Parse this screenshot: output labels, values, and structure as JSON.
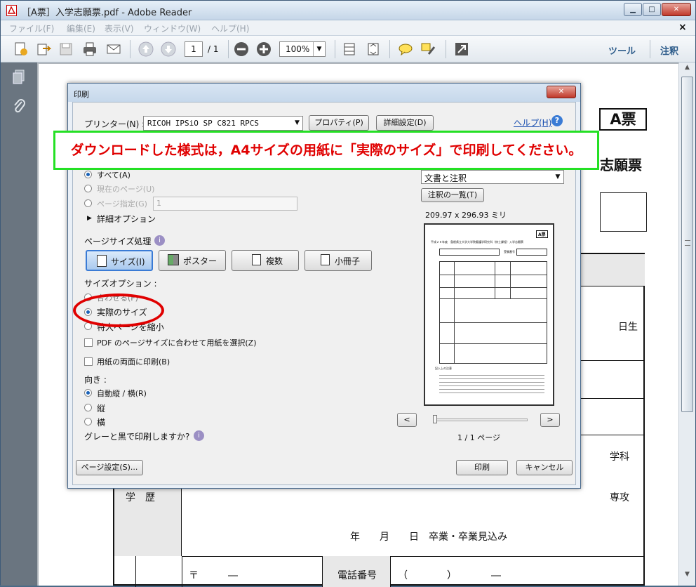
{
  "window": {
    "title": "［A票］入学志願票.pdf - Adobe Reader",
    "controls": [
      "▁",
      "□",
      "✕"
    ],
    "close_doc": "×"
  },
  "menu": [
    "ファイル(F)",
    "編集(E)",
    "表示(V)",
    "ウィンドウ(W)",
    "ヘルプ(H)"
  ],
  "toolbar": {
    "page_current": "1",
    "page_total": "/ 1",
    "zoom": "100%",
    "tools": "ツール",
    "comment": "注釈"
  },
  "document": {
    "badge": "A票",
    "heading": "志願票",
    "right_text_1": "日生",
    "right_text_2": "学科",
    "right_text_3": "専攻",
    "education_label": "学　歴",
    "graduation_line": "年　　月　　日　卒業・卒業見込み",
    "postal": "〒　　　―",
    "phone_label": "電話番号",
    "phone_value": "（　　　　）　　　　―"
  },
  "dialog": {
    "title": "印刷",
    "close": "✕",
    "printer_label": "プリンター(N) :",
    "printer_value": "RICOH IPSiO SP C821 RPCS",
    "properties": "プロパティ(P)",
    "advanced": "詳細設定(D)",
    "help": "ヘルプ(H)",
    "range_all": "すべて(A)",
    "range_current": "現在のページ(U)",
    "range_pages": "ページ指定(G)",
    "range_pages_value": "1",
    "more_options": "詳細オプション",
    "comments_value": "文書と注釈",
    "summarize": "注釈の一覧(T)",
    "paper_size": "209.97 x 296.93 ミリ",
    "page_handling": "ページサイズ処理",
    "mode_size": "サイズ(I)",
    "mode_poster": "ポスター",
    "mode_multiple": "複数",
    "mode_booklet": "小冊子",
    "size_options": "サイズオプション :",
    "opt_fit": "合わせる(F)",
    "opt_actual": "実際のサイズ",
    "opt_shrink": "特大ページを縮小",
    "choose_paper": "PDF のページサイズに合わせて用紙を選択(Z)",
    "duplex": "用紙の両面に印刷(B)",
    "orientation": "向き :",
    "orient_auto": "自動縦 / 横(R)",
    "orient_portrait": "縦",
    "orient_landscape": "横",
    "grayscale": "グレーと黒で印刷しますか?",
    "prev": "<",
    "next": ">",
    "page_count": "1 / 1 ページ",
    "page_setup": "ページ設定(S)...",
    "print": "印刷",
    "cancel": "キャンセル",
    "preview": {
      "badge": "A票",
      "heading": "平成２８年度　島根県立大学大学院看護学研究科（修士課程）入学志願票",
      "exam_label": "受験番号",
      "note_title": "記入上の注意"
    }
  },
  "banner": "ダウンロードした様式は，A4サイズの用紙に「実際のサイズ」で印刷してください。",
  "colors": {
    "banner_border": "#24e024",
    "banner_text": "#e00000",
    "annotation_circle": "#e00000"
  }
}
